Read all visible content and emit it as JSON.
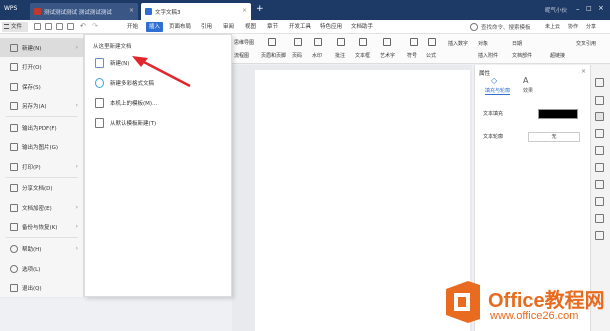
{
  "titlebar": {
    "app_name": "WPS",
    "tab1": "测试测试测试 测试测试测试",
    "tab2": "文字文稿3",
    "right_user": "昵气小伙"
  },
  "menubar": {
    "file_button": "文件",
    "tabs": [
      "开始",
      "插入",
      "页面布局",
      "引用",
      "审阅",
      "视图",
      "章节",
      "开发工具",
      "特色应用",
      "文档助手"
    ],
    "active_tab": "插入",
    "search_placeholder": "查找命令、搜索模板",
    "actions": [
      "未上云",
      "协作",
      "分享"
    ]
  },
  "ribbon": {
    "items": [
      "思维导图",
      "流程图",
      "页眉和页脚",
      "页码",
      "水印",
      "批注",
      "文本框",
      "艺术字",
      "符号",
      "公式",
      "插入数字",
      "对象",
      "日期",
      "插入附件",
      "文档部件",
      "超链接",
      "交叉引用"
    ]
  },
  "filemenu": {
    "items": [
      {
        "label": "新建(N)",
        "arrow": "›"
      },
      {
        "label": "打开(O)",
        "arrow": ""
      },
      {
        "label": "保存(S)",
        "arrow": ""
      },
      {
        "label": "另存为(A)",
        "arrow": "›"
      },
      {
        "label": "输出为PDF(F)",
        "arrow": ""
      },
      {
        "label": "输出为图片(G)",
        "arrow": ""
      },
      {
        "label": "打印(P)",
        "arrow": "›"
      },
      {
        "label": "分享文档(D)",
        "arrow": ""
      },
      {
        "label": "文档加密(E)",
        "arrow": "›"
      },
      {
        "label": "备份与恢复(K)",
        "arrow": "›"
      },
      {
        "label": "帮助(H)",
        "arrow": "›"
      },
      {
        "label": "选项(L)",
        "arrow": ""
      },
      {
        "label": "退出(Q)",
        "arrow": ""
      }
    ]
  },
  "subpanel": {
    "title": "从这里新建文档",
    "items": [
      "新建(N)",
      "新建多彩格式文稿",
      "本机上的模板(M)...",
      "从默认模板新建(T)"
    ]
  },
  "rpanel": {
    "title": "属性",
    "tabs": [
      "填充与轮廓",
      "效果"
    ],
    "rows": [
      "文本填充",
      "文本轮廓"
    ],
    "outline_value": "无"
  },
  "watermark": {
    "main": "Office教程网",
    "sub": "www.office26.com"
  },
  "colors": {
    "titlebar": "#1d3a66",
    "accent": "#2f6fd3",
    "watermark": "#e86b1f",
    "arrow": "#e0262c"
  }
}
